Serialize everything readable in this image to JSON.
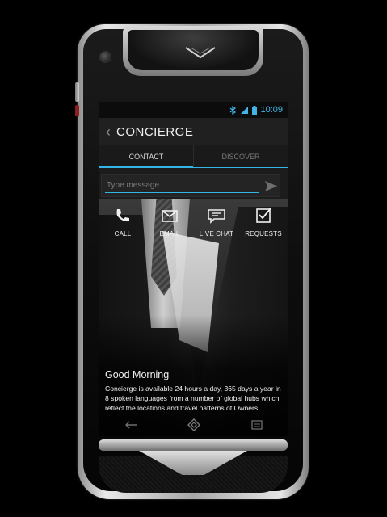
{
  "status_bar": {
    "time": "10:09",
    "icons": [
      "bluetooth-icon",
      "signal-icon",
      "battery-icon"
    ]
  },
  "header": {
    "title": "CONCIERGE",
    "back_icon": "chevron-left-icon"
  },
  "tabs": [
    {
      "label": "CONTACT",
      "active": true
    },
    {
      "label": "DISCOVER",
      "active": false
    }
  ],
  "compose": {
    "placeholder": "Type message",
    "send_icon": "send-icon"
  },
  "actions": [
    {
      "label": "CALL",
      "icon": "phone-icon"
    },
    {
      "label": "EMAIL",
      "icon": "envelope-icon"
    },
    {
      "label": "LIVE CHAT",
      "icon": "chat-icon"
    },
    {
      "label": "REQUESTS",
      "icon": "checklist-icon"
    }
  ],
  "content": {
    "greeting": "Good Morning",
    "description": "Concierge is available 24 hours a day, 365 days a year in 8 spoken languages from a number of global hubs which reflect the locations and travel patterns of  Owners."
  },
  "nav_icons": [
    "back-arrow-icon",
    "home-icon",
    "recent-apps-icon"
  ],
  "colors": {
    "accent": "#33b5e5",
    "status": "#41b6e6",
    "background": "#000000"
  }
}
